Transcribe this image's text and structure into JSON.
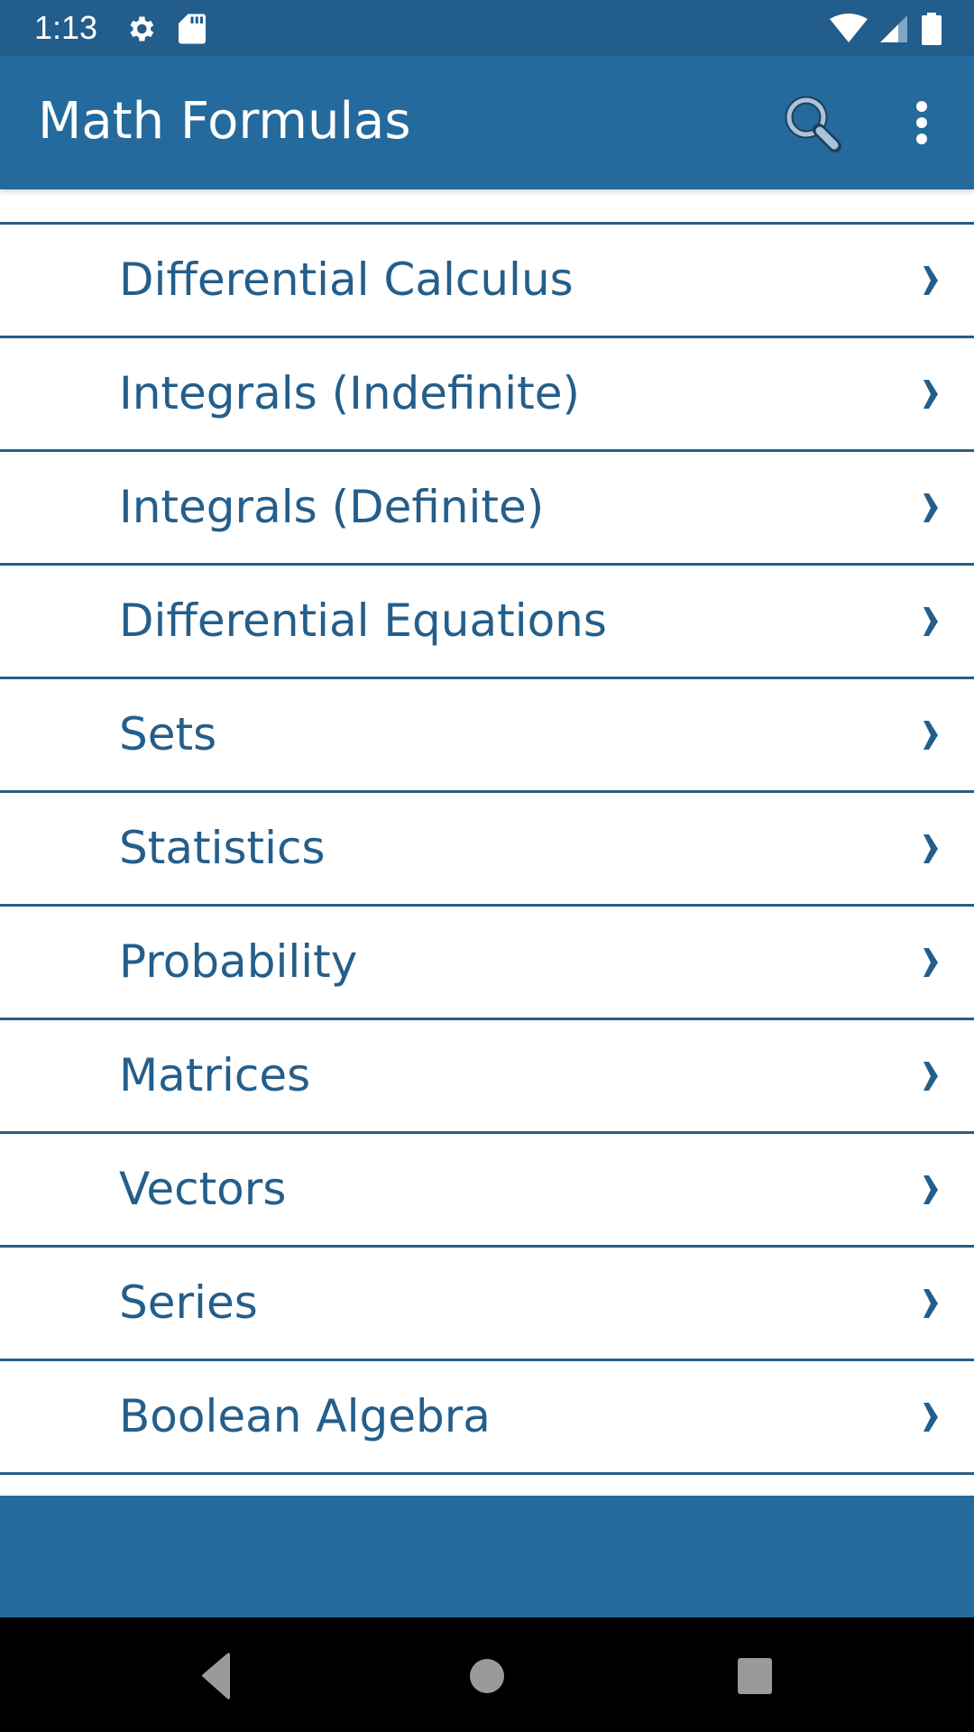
{
  "status_bar": {
    "time": "1:13",
    "left_icons": [
      "settings-gear-icon",
      "sd-card-icon"
    ],
    "right_icons": [
      "wifi-icon",
      "cell-signal-icon",
      "battery-icon"
    ]
  },
  "app_bar": {
    "title": "Math Formulas",
    "actions": [
      "search-icon",
      "overflow-menu-icon"
    ]
  },
  "list": {
    "items": [
      {
        "label": "Differential Calculus"
      },
      {
        "label": "Integrals (Indefinite)"
      },
      {
        "label": "Integrals (Definite)"
      },
      {
        "label": "Differential Equations"
      },
      {
        "label": "Sets"
      },
      {
        "label": "Statistics"
      },
      {
        "label": "Probability"
      },
      {
        "label": "Matrices"
      },
      {
        "label": "Vectors"
      },
      {
        "label": "Series"
      },
      {
        "label": "Boolean Algebra"
      }
    ],
    "chevron": "›"
  },
  "colors": {
    "status_bar": "#225d8c",
    "app_bar": "#246a9c",
    "text": "#245e8b",
    "divider": "#265d87",
    "nav_bar": "#000000",
    "nav_icons": "#9a9a9a"
  },
  "nav_bar": {
    "buttons": [
      "back",
      "home",
      "recents"
    ]
  }
}
